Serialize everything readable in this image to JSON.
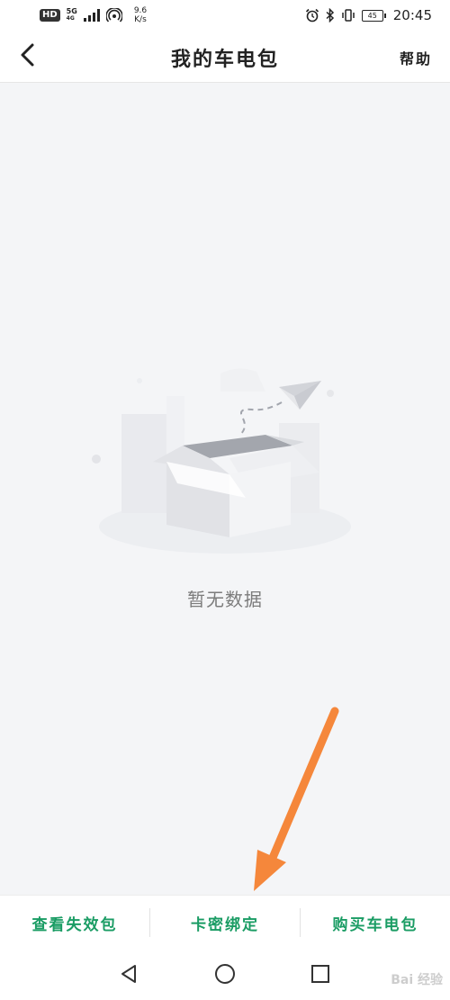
{
  "status_bar": {
    "hd": "HD",
    "net_5g": "5G",
    "net_sub": "4G",
    "speed_value": "9.6",
    "speed_unit": "K/s",
    "battery": "45",
    "time": "20:45"
  },
  "header": {
    "title": "我的车电包",
    "help_label": "帮助"
  },
  "empty_state": {
    "text": "暂无数据"
  },
  "bottom_bar": {
    "items": [
      {
        "label": "查看失效包"
      },
      {
        "label": "卡密绑定"
      },
      {
        "label": "购买车电包"
      }
    ]
  },
  "colors": {
    "accent": "#1a9c64",
    "annotation_arrow": "#f5873b"
  },
  "watermark": "Bai 经验"
}
